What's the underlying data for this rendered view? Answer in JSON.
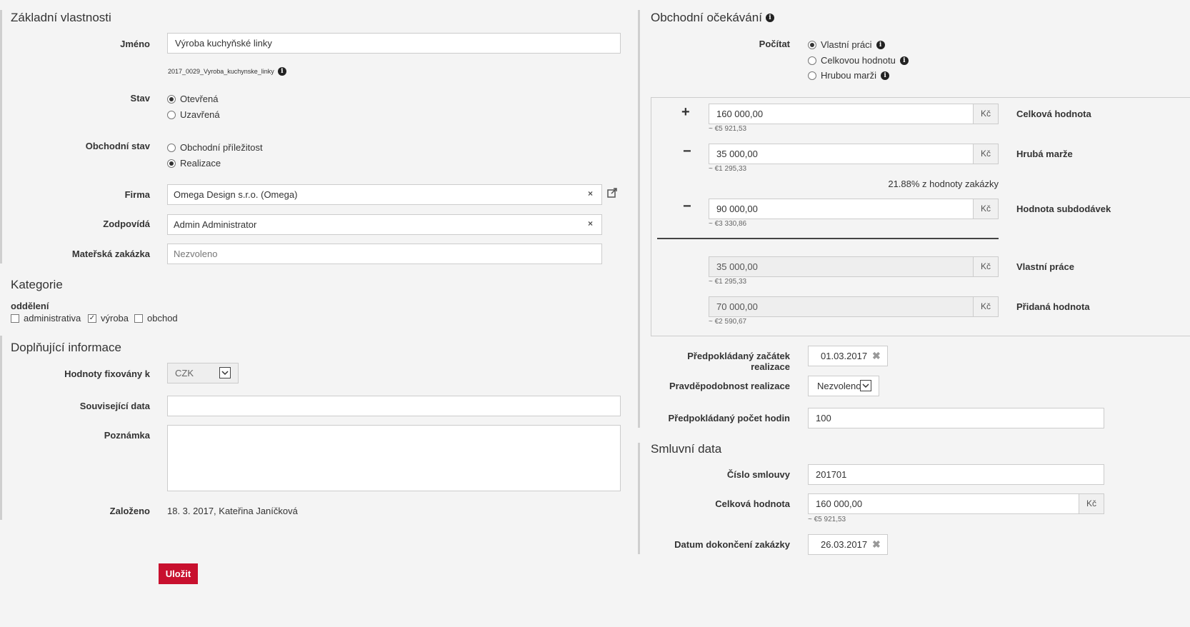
{
  "basic": {
    "title": "Základní vlastnosti",
    "name_label": "Jméno",
    "name_value": "Výroba kuchyňské linky",
    "code": "2017_0029_Vyroba_kuchynske_linky",
    "state_label": "Stav",
    "state_options": [
      "Otevřená",
      "Uzavřená"
    ],
    "state_selected": "Otevřená",
    "bstate_label": "Obchodní stav",
    "bstate_options": [
      "Obchodní příležitost",
      "Realizace"
    ],
    "bstate_selected": "Realizace",
    "firm_label": "Firma",
    "firm_value": "Omega Design s.r.o. (Omega)",
    "resp_label": "Zodpovídá",
    "resp_value": "Admin Administrator",
    "parent_label": "Mateřská zakázka",
    "parent_placeholder": "Nezvoleno"
  },
  "categories": {
    "title": "Kategorie",
    "group_label": "oddělení",
    "items": [
      {
        "label": "administrativa",
        "checked": false
      },
      {
        "label": "výroba",
        "checked": true
      },
      {
        "label": "obchod",
        "checked": false
      }
    ]
  },
  "extra": {
    "title": "Doplňující informace",
    "fixed_label": "Hodnoty fixovány k",
    "fixed_value": "CZK",
    "related_label": "Související data",
    "related_value": "",
    "note_label": "Poznámka",
    "note_value": "",
    "created_label": "Založeno",
    "created_value": "18. 3. 2017, Kateřina Janíčková"
  },
  "save_label": "Uložit",
  "expect": {
    "title": "Obchodní očekávání",
    "count_label": "Počítat",
    "count_options": [
      "Vlastní práci",
      "Celkovou hodnotu",
      "Hrubou marži"
    ],
    "count_selected": "Vlastní práci",
    "currency": "Kč",
    "plus_sign": "+",
    "minus_sign": "−",
    "total_value": "160 000,00",
    "total_eur": "~ €5 921,53",
    "total_label": "Celková hodnota",
    "margin_value": "35 000,00",
    "margin_eur": "~ €1 295,33",
    "margin_label": "Hrubá marže",
    "margin_pct": "21.88% z hodnoty zakázky",
    "sub_value": "90 000,00",
    "sub_eur": "~ €3 330,86",
    "sub_label": "Hodnota subdodávek",
    "own_value": "35 000,00",
    "own_eur": "~ €1 295,33",
    "own_label": "Vlastní práce",
    "added_value": "70 000,00",
    "added_eur": "~ €2 590,67",
    "added_label": "Přidaná hodnota",
    "start_label": "Předpokládaný začátek realizace",
    "start_value": "01.03.2017",
    "prob_label": "Pravděpodobnost realizace",
    "prob_value": "Nezvoleno",
    "hours_label": "Předpokládaný počet hodin",
    "hours_value": "100"
  },
  "contract": {
    "title": "Smluvní data",
    "number_label": "Číslo smlouvy",
    "number_value": "201701",
    "total_label": "Celková hodnota",
    "total_value": "160 000,00",
    "total_eur": "~ €5 921,53",
    "end_label": "Datum dokončení zakázky",
    "end_value": "26.03.2017"
  }
}
